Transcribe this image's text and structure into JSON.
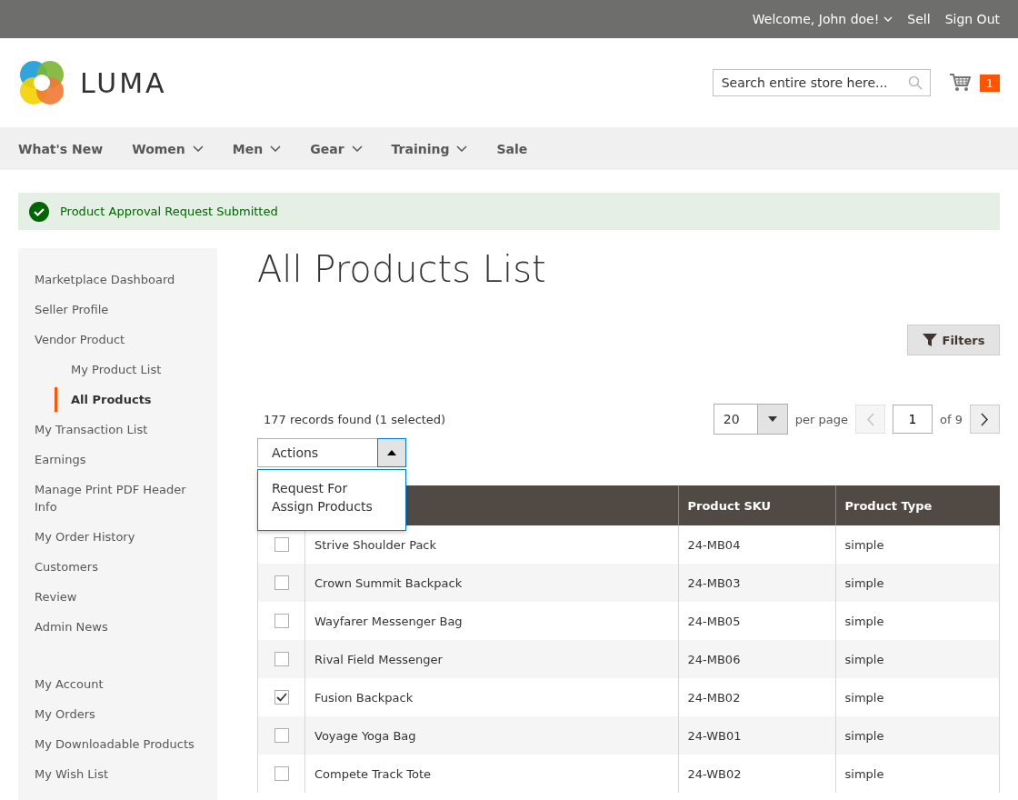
{
  "top_bar": {
    "welcome": "Welcome, John doe!",
    "links": [
      "Sell",
      "Sign Out"
    ]
  },
  "header": {
    "logo_text": "LUMA",
    "search": {
      "placeholder": "Search entire store here..."
    },
    "cart_count": "1"
  },
  "nav": [
    {
      "label": "What's New",
      "has_menu": false
    },
    {
      "label": "Women",
      "has_menu": true
    },
    {
      "label": "Men",
      "has_menu": true
    },
    {
      "label": "Gear",
      "has_menu": true
    },
    {
      "label": "Training",
      "has_menu": true
    },
    {
      "label": "Sale",
      "has_menu": false
    }
  ],
  "message": {
    "kind": "success",
    "text": "Product Approval Request Submitted"
  },
  "sidebar": {
    "groups": [
      [
        {
          "label": "Marketplace Dashboard",
          "selected": false
        },
        {
          "label": "Seller Profile",
          "selected": false
        },
        {
          "label": "Vendor Product",
          "selected": false,
          "children": [
            {
              "label": "My Product List",
              "selected": false
            },
            {
              "label": "All Products",
              "selected": true
            }
          ]
        },
        {
          "label": "My Transaction List",
          "selected": false
        },
        {
          "label": "Earnings",
          "selected": false
        },
        {
          "label": "Manage Print PDF Header Info",
          "selected": false
        },
        {
          "label": "My Order History",
          "selected": false
        },
        {
          "label": "Customers",
          "selected": false
        },
        {
          "label": "Review",
          "selected": false
        },
        {
          "label": "Admin News",
          "selected": false
        }
      ],
      [
        {
          "label": "My Account",
          "selected": false
        },
        {
          "label": "My Orders",
          "selected": false
        },
        {
          "label": "My Downloadable Products",
          "selected": false
        },
        {
          "label": "My Wish List",
          "selected": false
        }
      ]
    ]
  },
  "page_title": "All Products List",
  "filters_button": "Filters",
  "records": "177 records found (1 selected)",
  "pager": {
    "per_page_value": "20",
    "per_page_label": "per page",
    "page": "1",
    "of_pages": "of 9",
    "prev_disabled": true
  },
  "actions": {
    "label": "Actions",
    "expanded": true,
    "options": [
      "Request For Assign Products"
    ]
  },
  "table": {
    "columns": [
      "",
      "",
      "Product SKU",
      "Product Type"
    ],
    "rows": [
      {
        "checked": false,
        "name": "Strive Shoulder Pack",
        "sku": "24-MB04",
        "type": "simple"
      },
      {
        "checked": false,
        "name": "Crown Summit Backpack",
        "sku": "24-MB03",
        "type": "simple"
      },
      {
        "checked": false,
        "name": "Wayfarer Messenger Bag",
        "sku": "24-MB05",
        "type": "simple"
      },
      {
        "checked": false,
        "name": "Rival Field Messenger",
        "sku": "24-MB06",
        "type": "simple"
      },
      {
        "checked": true,
        "name": "Fusion Backpack",
        "sku": "24-MB02",
        "type": "simple"
      },
      {
        "checked": false,
        "name": "Voyage Yoga Bag",
        "sku": "24-WB01",
        "type": "simple"
      },
      {
        "checked": false,
        "name": "Compete Track Tote",
        "sku": "24-WB02",
        "type": "simple"
      }
    ]
  }
}
